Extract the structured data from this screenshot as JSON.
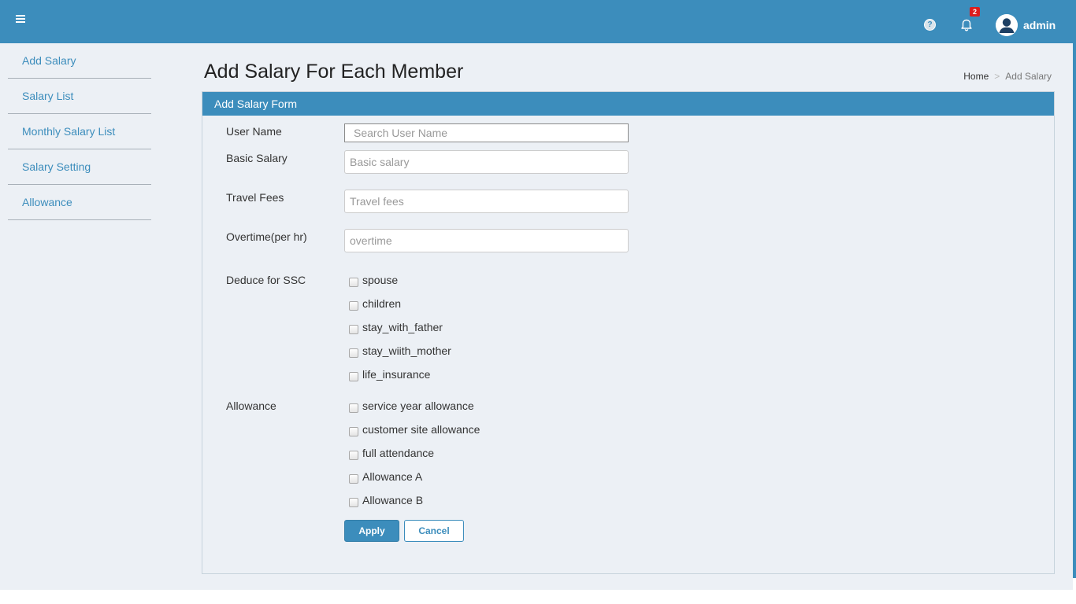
{
  "header": {
    "help_glyph": "?",
    "notification_count": "2",
    "user_name": "admin",
    "bar_color": "#3c8dbc"
  },
  "sidebar": {
    "items": [
      {
        "label": "Add Salary"
      },
      {
        "label": "Salary List"
      },
      {
        "label": "Monthly Salary List"
      },
      {
        "label": "Salary Setting"
      },
      {
        "label": "Allowance"
      }
    ]
  },
  "page": {
    "title": "Add Salary For Each Member",
    "breadcrumb": {
      "home": "Home",
      "separator": ">",
      "current": "Add Salary"
    }
  },
  "form": {
    "header": "Add Salary Form",
    "user_name": {
      "label": "User Name",
      "placeholder": "Search User Name",
      "value": ""
    },
    "basic_salary": {
      "label": "Basic Salary",
      "placeholder": "Basic salary",
      "value": ""
    },
    "travel_fees": {
      "label": "Travel Fees",
      "placeholder": "Travel fees",
      "value": ""
    },
    "overtime": {
      "label": "Overtime(per hr)",
      "placeholder": "overtime",
      "value": ""
    },
    "deduce_label": "Deduce for SSC",
    "deduce_options": [
      {
        "label": "spouse",
        "checked": false
      },
      {
        "label": "children",
        "checked": false
      },
      {
        "label": "stay_with_father",
        "checked": false
      },
      {
        "label": "stay_wiith_mother",
        "checked": false
      },
      {
        "label": "life_insurance",
        "checked": false
      }
    ],
    "allowance_label": "Allowance",
    "allowance_options": [
      {
        "label": "service year allowance",
        "checked": false
      },
      {
        "label": "customer site allowance",
        "checked": false
      },
      {
        "label": "full attendance",
        "checked": false
      },
      {
        "label": "Allowance A",
        "checked": false
      },
      {
        "label": "Allowance B",
        "checked": false
      }
    ],
    "apply_label": "Apply",
    "cancel_label": "Cancel"
  }
}
